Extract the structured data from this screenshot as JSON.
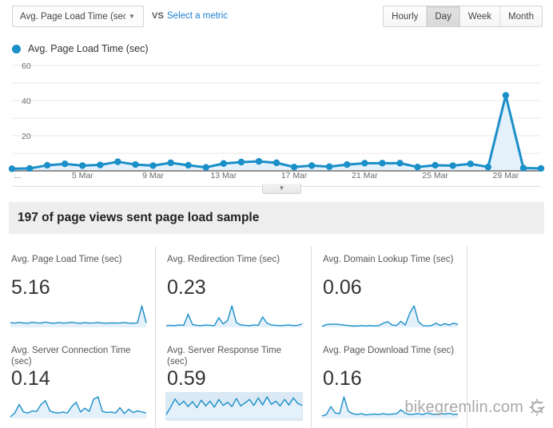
{
  "toolbar": {
    "metric_select": {
      "value": "Avg. Page Load Time (sec)",
      "caret_icon": "chevron-down-icon"
    },
    "vs_text": "VS",
    "select_metric_link": "Select a metric",
    "period_buttons": [
      {
        "label": "Hourly",
        "active": false
      },
      {
        "label": "Day",
        "active": true
      },
      {
        "label": "Week",
        "active": false
      },
      {
        "label": "Month",
        "active": false
      }
    ]
  },
  "legend": {
    "series_label": "Avg. Page Load Time (sec)",
    "dot_color": "#1a8fc8"
  },
  "chart_controls": {
    "collapse_handle_icon": "chevron-down-icon"
  },
  "banner": {
    "text": "197 of page views sent page load sample",
    "count": "197"
  },
  "cards": [
    {
      "title": "Avg. Page Load Time (sec)",
      "value": "5.16",
      "selected": false,
      "sparkline": [
        3.6,
        3.3,
        3.8,
        3.4,
        3.2,
        3.9,
        3.5,
        3.3,
        4.1,
        3.4,
        3.2,
        3.7,
        3.3,
        3.5,
        4.0,
        3.4,
        3.2,
        3.6,
        3.3,
        3.4,
        3.8,
        3.3,
        3.2,
        3.5,
        3.3,
        3.4,
        3.7,
        3.3,
        3.2,
        3.5,
        16.5,
        3.4
      ]
    },
    {
      "title": "Avg. Redirection Time (sec)",
      "value": "0.23",
      "selected": false,
      "sparkline": [
        0.05,
        0.06,
        0.05,
        0.07,
        0.06,
        0.38,
        0.08,
        0.06,
        0.05,
        0.07,
        0.06,
        0.05,
        0.28,
        0.1,
        0.2,
        0.62,
        0.14,
        0.07,
        0.06,
        0.05,
        0.07,
        0.06,
        0.3,
        0.12,
        0.07,
        0.06,
        0.05,
        0.06,
        0.07,
        0.05,
        0.06,
        0.1
      ]
    },
    {
      "title": "Avg. Domain Lookup Time (sec)",
      "value": "0.06",
      "selected": false,
      "sparkline": [
        0.02,
        0.06,
        0.07,
        0.07,
        0.06,
        0.05,
        0.04,
        0.03,
        0.03,
        0.04,
        0.03,
        0.04,
        0.03,
        0.04,
        0.09,
        0.12,
        0.05,
        0.04,
        0.13,
        0.05,
        0.3,
        0.46,
        0.12,
        0.04,
        0.03,
        0.04,
        0.09,
        0.04,
        0.08,
        0.05,
        0.09,
        0.06
      ]
    },
    {
      "title": "Avg. Server Connection Time (sec)",
      "value": "0.14",
      "selected": false,
      "sparkline": [
        0.03,
        0.1,
        0.26,
        0.12,
        0.1,
        0.14,
        0.13,
        0.26,
        0.33,
        0.14,
        0.11,
        0.1,
        0.12,
        0.1,
        0.22,
        0.3,
        0.12,
        0.19,
        0.13,
        0.36,
        0.4,
        0.13,
        0.11,
        0.12,
        0.1,
        0.2,
        0.09,
        0.17,
        0.11,
        0.14,
        0.12,
        0.1
      ]
    },
    {
      "title": "Avg. Server Response Time (sec)",
      "value": "0.59",
      "selected": true,
      "sparkline": [
        0.18,
        0.52,
        0.9,
        0.62,
        0.8,
        0.55,
        0.78,
        0.5,
        0.85,
        0.58,
        0.8,
        0.52,
        0.88,
        0.6,
        0.75,
        0.55,
        0.92,
        0.58,
        0.72,
        0.88,
        0.6,
        0.95,
        0.62,
        1.0,
        0.65,
        0.8,
        0.58,
        0.88,
        0.62,
        0.95,
        0.7,
        0.6
      ]
    },
    {
      "title": "Avg. Page Download Time (sec)",
      "value": "0.16",
      "selected": false,
      "sparkline": [
        0.06,
        0.1,
        0.3,
        0.14,
        0.12,
        0.55,
        0.18,
        0.12,
        0.1,
        0.12,
        0.09,
        0.1,
        0.11,
        0.1,
        0.12,
        0.1,
        0.11,
        0.12,
        0.22,
        0.13,
        0.1,
        0.11,
        0.12,
        0.1,
        0.14,
        0.11,
        0.1,
        0.12,
        0.11,
        0.13,
        0.1,
        0.11
      ]
    }
  ],
  "watermark": {
    "text": "bikegremlin.com",
    "logo_icon": "gear-g-icon"
  },
  "chart_data": {
    "type": "line",
    "title": "",
    "series_name": "Avg. Page Load Time (sec)",
    "xlabel": "",
    "ylabel": "",
    "ylim": [
      0,
      60
    ],
    "y_ticks": [
      20,
      40,
      60
    ],
    "grid": true,
    "legend_position": "top-left",
    "x_tick_labels": [
      "...",
      "5 Mar",
      "9 Mar",
      "13 Mar",
      "17 Mar",
      "21 Mar",
      "25 Mar",
      "29 Mar"
    ],
    "x": [
      "1 Mar",
      "2 Mar",
      "3 Mar",
      "4 Mar",
      "5 Mar",
      "6 Mar",
      "7 Mar",
      "8 Mar",
      "9 Mar",
      "10 Mar",
      "11 Mar",
      "12 Mar",
      "13 Mar",
      "14 Mar",
      "15 Mar",
      "16 Mar",
      "17 Mar",
      "18 Mar",
      "19 Mar",
      "20 Mar",
      "21 Mar",
      "22 Mar",
      "23 Mar",
      "24 Mar",
      "25 Mar",
      "26 Mar",
      "27 Mar",
      "28 Mar",
      "29 Mar",
      "30 Mar",
      "31 Mar"
    ],
    "values": [
      1.2,
      1.4,
      3.2,
      4.0,
      3.0,
      3.4,
      5.2,
      3.6,
      3.0,
      4.6,
      3.2,
      2.0,
      4.2,
      5.0,
      5.4,
      4.6,
      2.2,
      3.0,
      2.4,
      3.6,
      4.4,
      4.4,
      4.4,
      2.2,
      3.2,
      3.0,
      4.0,
      2.2,
      43.0,
      1.6,
      1.4
    ],
    "series": [
      {
        "name": "Avg. Page Load Time (sec)",
        "color": "#1a8fc8",
        "values": [
          1.2,
          1.4,
          3.2,
          4.0,
          3.0,
          3.4,
          5.2,
          3.6,
          3.0,
          4.6,
          3.2,
          2.0,
          4.2,
          5.0,
          5.4,
          4.6,
          2.2,
          3.0,
          2.4,
          3.6,
          4.4,
          4.4,
          4.4,
          2.2,
          3.2,
          3.0,
          4.0,
          2.2,
          43.0,
          1.6,
          1.4
        ]
      }
    ]
  }
}
